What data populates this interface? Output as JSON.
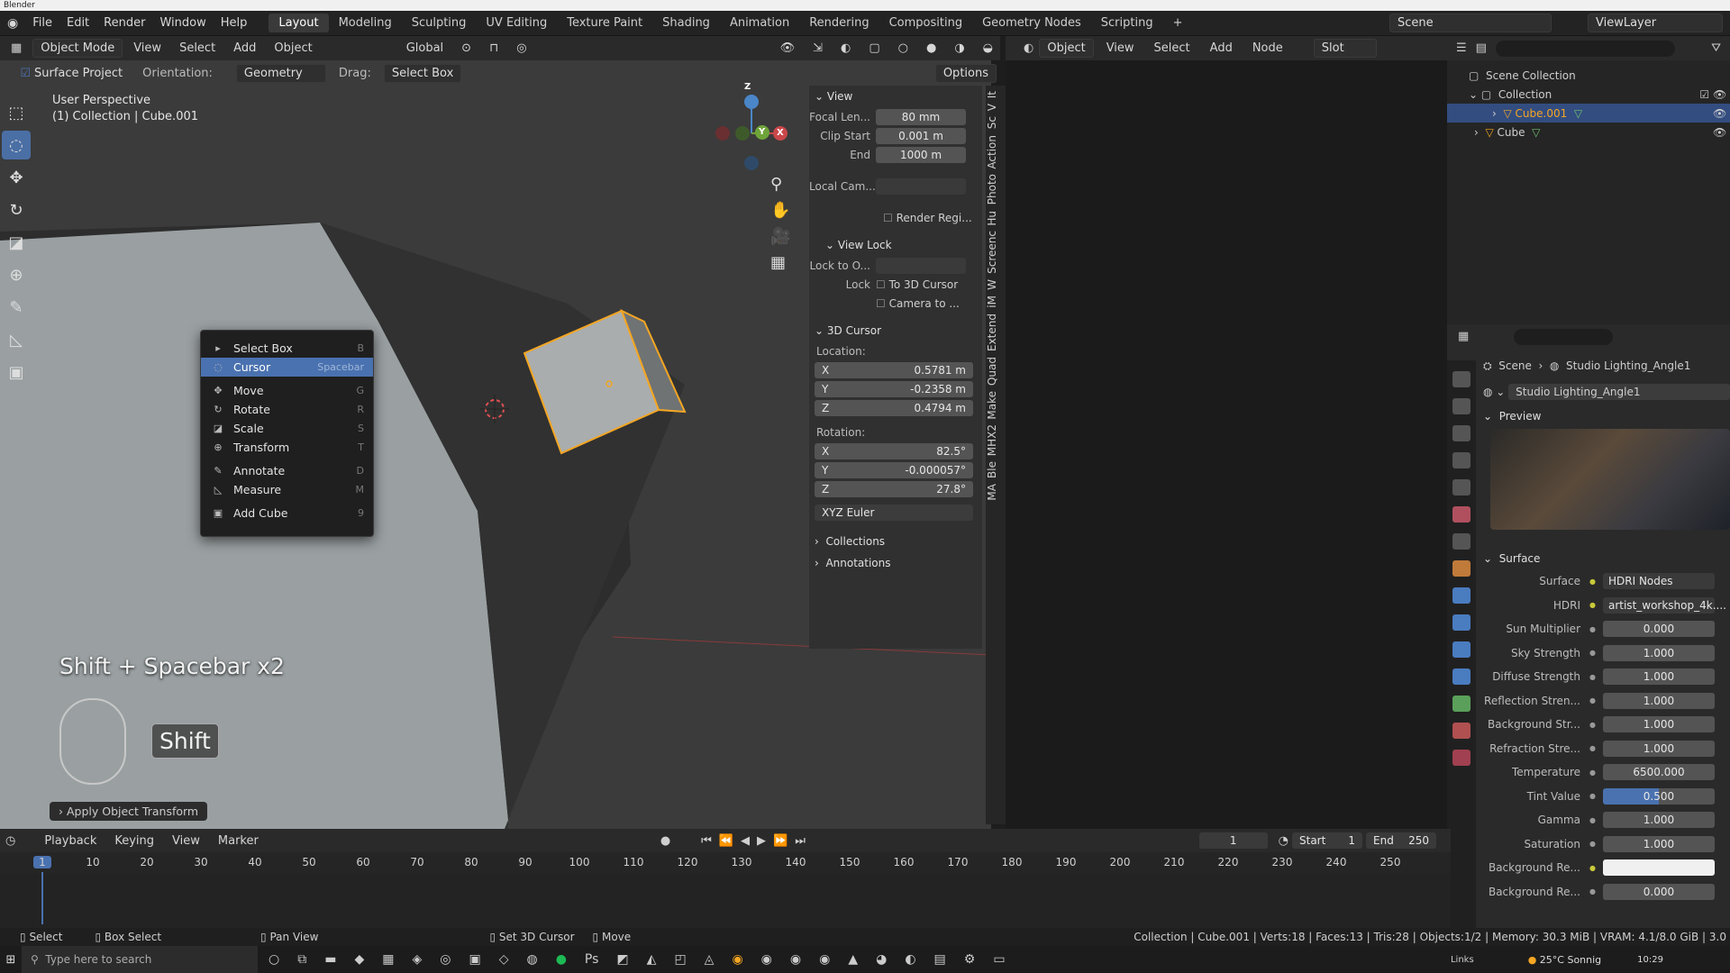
{
  "app": {
    "title": "Blender"
  },
  "top_menu": [
    "File",
    "Edit",
    "Render",
    "Window",
    "Help"
  ],
  "workspaces": [
    "Layout",
    "Modeling",
    "Sculpting",
    "UV Editing",
    "Texture Paint",
    "Shading",
    "Animation",
    "Rendering",
    "Compositing",
    "Geometry Nodes",
    "Scripting"
  ],
  "scene": {
    "label": "Scene",
    "viewlayer": "ViewLayer"
  },
  "header3d": {
    "mode": "Object Mode",
    "items": [
      "View",
      "Select",
      "Add",
      "Object"
    ],
    "orientation": "Global"
  },
  "tool_options": {
    "surface_project": "Surface Project",
    "orientation_label": "Orientation:",
    "orientation_value": "Geometry",
    "drag_label": "Drag:",
    "drag_value": "Select Box",
    "options": "Options"
  },
  "viewport": {
    "perspective": "User Perspective",
    "collection": "(1) Collection | Cube.001"
  },
  "gizmo": {
    "z": "Z",
    "x": "X",
    "y": "Y"
  },
  "context_menu": [
    {
      "label": "Select Box",
      "key": "B",
      "icon": "▸"
    },
    {
      "label": "Cursor",
      "key": "Spacebar",
      "icon": "◌",
      "highlight": true
    },
    {
      "label": "Move",
      "key": "G",
      "icon": "✥"
    },
    {
      "label": "Rotate",
      "key": "R",
      "icon": "↻"
    },
    {
      "label": "Scale",
      "key": "S",
      "icon": "◪"
    },
    {
      "label": "Transform",
      "key": "T",
      "icon": "⊕"
    },
    {
      "label": "Annotate",
      "key": "D",
      "icon": "✎"
    },
    {
      "label": "Measure",
      "key": "M",
      "icon": "◺"
    },
    {
      "label": "Add Cube",
      "key": "9",
      "icon": "▣"
    }
  ],
  "overlay": {
    "shortcut": "Shift + Spacebar x2",
    "key_badge": "Shift"
  },
  "operator_panel": "Apply Object Transform",
  "npanel": {
    "view_title": "View",
    "focal_label": "Focal Len...",
    "focal": "80 mm",
    "clip_start_label": "Clip Start",
    "clip_start": "0.001 m",
    "end_label": "End",
    "end": "1000 m",
    "local_cam_label": "Local Cam...",
    "render_region": "Render Regi...",
    "view_lock_title": "View Lock",
    "lock_to_label": "Lock to O...",
    "lock_label": "Lock",
    "to_3d_cursor": "To 3D Cursor",
    "camera_to": "Camera to ...",
    "cursor_title": "3D Cursor",
    "location_label": "Location:",
    "loc": {
      "x": "0.5781 m",
      "y": "-0.2358 m",
      "z": "0.4794 m"
    },
    "rotation_label": "Rotation:",
    "rot": {
      "x": "82.5°",
      "y": "-0.000057°",
      "z": "27.8°"
    },
    "rot_mode": "XYZ Euler",
    "collections": "Collections",
    "annotations": "Annotations"
  },
  "side_tabs": [
    "It",
    "V",
    "Sc",
    "Action",
    "Photo",
    "Hu",
    "Screenc",
    "W",
    "iM",
    "Extend",
    "Quad",
    "Make",
    "MHX2",
    "Ble",
    "MA"
  ],
  "right_header": {
    "mode": "Object",
    "items": [
      "View",
      "Select",
      "Add",
      "Node"
    ],
    "slot": "Slot"
  },
  "outliner": {
    "root": "Scene Collection",
    "collection": "Collection",
    "items": [
      "Cube.001",
      "Cube"
    ]
  },
  "properties": {
    "breadcrumb_scene": "Scene",
    "breadcrumb_world": "Studio Lighting_Angle1",
    "world_name": "Studio Lighting_Angle1",
    "preview": "Preview",
    "surface_section": "Surface",
    "rows": [
      {
        "label": "Surface",
        "value": "HDRI Nodes"
      },
      {
        "label": "HDRI",
        "value": "artist_workshop_4k...."
      },
      {
        "label": "Sun Multiplier",
        "value": "0.000"
      },
      {
        "label": "Sky Strength",
        "value": "1.000"
      },
      {
        "label": "Diffuse Strength",
        "value": "1.000"
      },
      {
        "label": "Reflection Stren...",
        "value": "1.000"
      },
      {
        "label": "Background Str...",
        "value": "1.000"
      },
      {
        "label": "Refraction Stre...",
        "value": "1.000"
      },
      {
        "label": "Temperature",
        "value": "6500.000"
      },
      {
        "label": "Tint Value",
        "value": "0.500",
        "fill": 0.5
      },
      {
        "label": "Gamma",
        "value": "1.000"
      },
      {
        "label": "Saturation",
        "value": "1.000"
      },
      {
        "label": "Background Re...",
        "value": ""
      },
      {
        "label": "Background Re...",
        "value": "0.000"
      }
    ]
  },
  "timeline": {
    "menu": [
      "Playback",
      "Keying",
      "View",
      "Marker"
    ],
    "current": "1",
    "start_label": "Start",
    "start": "1",
    "end_label": "End",
    "end": "250",
    "ticks": [
      "1",
      "10",
      "20",
      "30",
      "40",
      "50",
      "60",
      "70",
      "80",
      "90",
      "100",
      "110",
      "120",
      "130",
      "140",
      "150",
      "160",
      "170",
      "180",
      "190",
      "200",
      "210",
      "220",
      "230",
      "240",
      "250"
    ]
  },
  "status": {
    "select": "Select",
    "box_select": "Box Select",
    "pan": "Pan View",
    "set_cursor": "Set 3D Cursor",
    "move": "Move",
    "info": "Collection | Cube.001 | Verts:18 | Faces:13 | Tris:28 | Objects:1/2 | Memory: 30.3 MiB | VRAM: 4.1/8.0 GiB | 3.0"
  },
  "taskbar": {
    "search": "Type here to search",
    "links": "Links",
    "weather": "25°C Sonnig",
    "time": "10:29"
  },
  "colors": {
    "accent": "#4a72b0",
    "selected_orange": "#f5a623",
    "red_axis": "#c9474a",
    "green_axis": "#6ea43a",
    "blue_axis": "#4a86c8"
  }
}
